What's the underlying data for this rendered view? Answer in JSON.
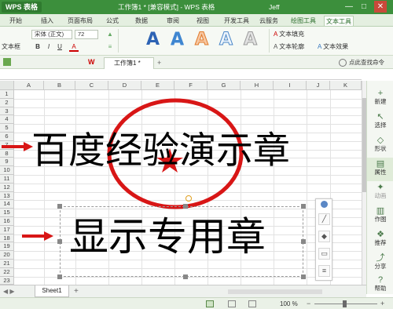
{
  "titlebar": {
    "app_badge": "WPS 表格",
    "document_title": "工作簿1 * [兼容模式] - WPS 表格",
    "user_name": "Jeff",
    "min_label": "—",
    "max_label": "□",
    "close_label": "✕"
  },
  "menu": {
    "tabs": [
      "开始",
      "插入",
      "页面布局",
      "公式",
      "数据",
      "审阅",
      "视图",
      "开发工具",
      "云服务",
      "绘图工具",
      "文本工具"
    ],
    "active": "文本工具"
  },
  "toolbar": {
    "font_name": "宋体 (正文)",
    "font_size": "72",
    "textbox_label": "文本框",
    "fill_label": "文本填充",
    "outline_label": "文本轮廓",
    "effect_label": "文本效果",
    "wordart_letters": [
      "A",
      "A",
      "A",
      "A",
      "A"
    ],
    "style_buttons": [
      "B",
      "I",
      "U",
      "A"
    ]
  },
  "tabstrip": {
    "doc_tab": "工作簿1 *",
    "find_command": "点此查找命令"
  },
  "grid": {
    "columns": [
      "A",
      "B",
      "C",
      "D",
      "E",
      "F",
      "G",
      "H",
      "I",
      "J",
      "K"
    ],
    "rows": [
      "1",
      "2",
      "3",
      "4",
      "5",
      "6",
      "7",
      "8",
      "9",
      "10",
      "11",
      "12",
      "13",
      "14",
      "15",
      "16",
      "17",
      "18",
      "19",
      "20",
      "21",
      "22",
      "23"
    ]
  },
  "stamp": {
    "line1": "百度经验演示章",
    "line2": "显示专用章",
    "ring_color": "#d81616",
    "star_color": "#d81616"
  },
  "sidepanel": {
    "items": [
      {
        "label": "新建",
        "icon": "new-icon"
      },
      {
        "label": "选择",
        "icon": "select-icon"
      },
      {
        "label": "形状",
        "icon": "shape-icon"
      },
      {
        "label": "属性",
        "icon": "property-icon"
      },
      {
        "label": "动画",
        "icon": "animation-icon"
      },
      {
        "label": "作图",
        "icon": "chart-icon"
      },
      {
        "label": "推荐",
        "icon": "recommend-icon"
      },
      {
        "label": "分享",
        "icon": "share-icon"
      },
      {
        "label": "帮助",
        "icon": "help-icon"
      }
    ]
  },
  "sheets": {
    "tabs": [
      "Sheet1"
    ],
    "add_label": "+"
  },
  "status": {
    "zoom": "100 %"
  }
}
